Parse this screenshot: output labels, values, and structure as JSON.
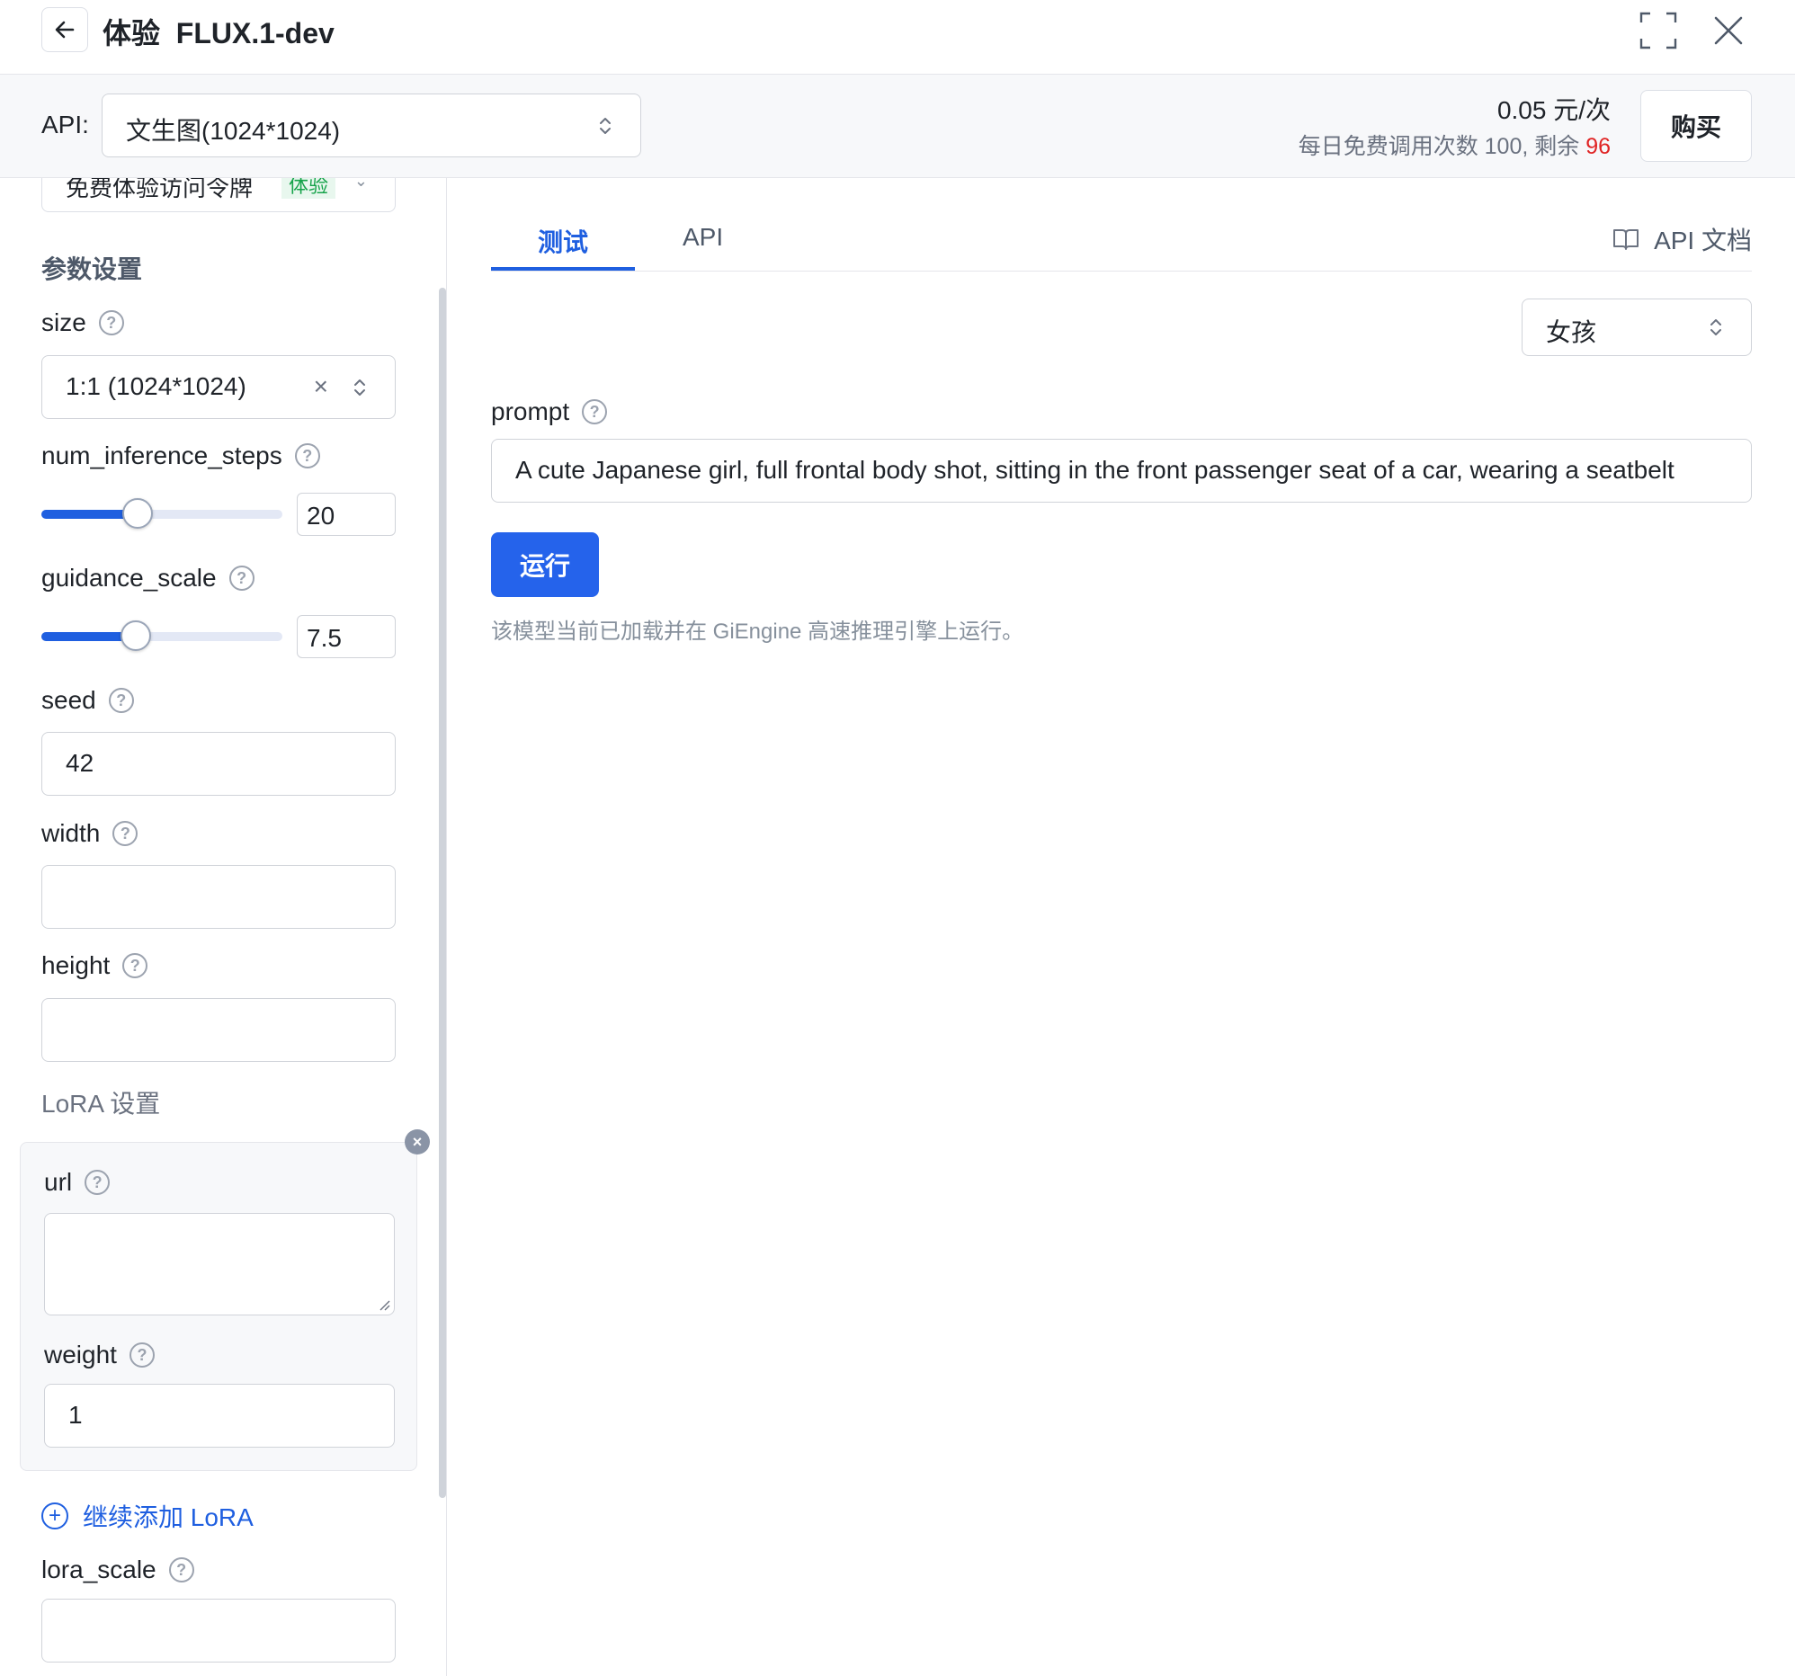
{
  "header": {
    "title": "体验  FLUX.1-dev"
  },
  "api_bar": {
    "label": "API:",
    "selected": "文生图(1024*1024)",
    "price": "0.05 元/次",
    "quota_prefix": "每日免费调用次数 100, 剩余 ",
    "quota_remaining": "96",
    "buy_label": "购买"
  },
  "sidebar": {
    "token_select": {
      "value": "免费体验访问令牌",
      "tag": "体验"
    },
    "params_title": "参数设置",
    "size": {
      "label": "size",
      "value": "1:1 (1024*1024)"
    },
    "num_inference_steps": {
      "label": "num_inference_steps",
      "value": "20",
      "slider_fraction": 0.4
    },
    "guidance_scale": {
      "label": "guidance_scale",
      "value": "7.5",
      "slider_fraction": 0.39
    },
    "seed": {
      "label": "seed",
      "value": "42"
    },
    "width": {
      "label": "width",
      "value": ""
    },
    "height": {
      "label": "height",
      "value": ""
    },
    "lora_title": "LoRA 设置",
    "lora": {
      "url_label": "url",
      "url_value": "",
      "weight_label": "weight",
      "weight_value": "1"
    },
    "add_lora_label": "继续添加 LoRA",
    "lora_scale": {
      "label": "lora_scale",
      "value": ""
    }
  },
  "main": {
    "tabs": [
      {
        "label": "测试",
        "active": true
      },
      {
        "label": "API",
        "active": false
      }
    ],
    "api_docs_label": "API 文档",
    "preset": "女孩",
    "prompt_label": "prompt",
    "prompt_value": "A cute Japanese girl, full frontal body shot, sitting in the front passenger seat of a car, wearing a seatbelt",
    "run_label": "运行",
    "engine_note": "该模型当前已加载并在 GiEngine 高速推理引擎上运行。"
  },
  "colors": {
    "accent": "#1f5fe0",
    "button": "#2563eb",
    "remaining": "#e02424",
    "tag_green": "#16a34a"
  },
  "icons": [
    "back-arrow-icon",
    "fullscreen-icon",
    "close-icon",
    "chevron-updown-icon",
    "clear-icon",
    "help-icon",
    "book-icon",
    "plus-circle-icon",
    "remove-icon"
  ]
}
